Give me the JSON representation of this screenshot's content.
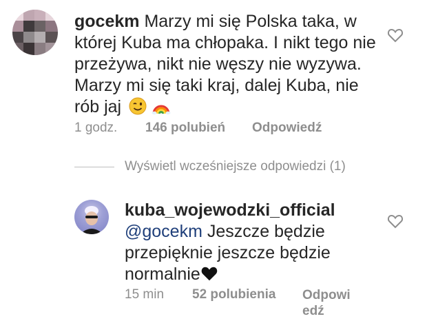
{
  "comment": {
    "username": "gocekm",
    "text": "Marzy mi się Polska taka, w której Kuba ma chłopaka. I nikt tego nie przeżywa, nikt nie węszy nie wyzywa. Marzy mi się taki kraj, dalej Kuba, nie rób jaj",
    "emojis": [
      "winking-face",
      "rainbow"
    ],
    "time": "1 godz.",
    "likes": "146 polubień",
    "reply_label": "Odpowiedź"
  },
  "view_replies": "Wyświetl wcześniejsze odpowiedzi (1)",
  "reply": {
    "username": "kuba_wojewodzki_official",
    "mention": "@gocekm",
    "text": " Jeszcze będzie przepięknie jeszcze będzie normalnie",
    "emojis": [
      "black-heart"
    ],
    "time": "15 min",
    "likes": "52 polubienia",
    "reply_label_line1": "Odpowi",
    "reply_label_line2": "edź"
  }
}
